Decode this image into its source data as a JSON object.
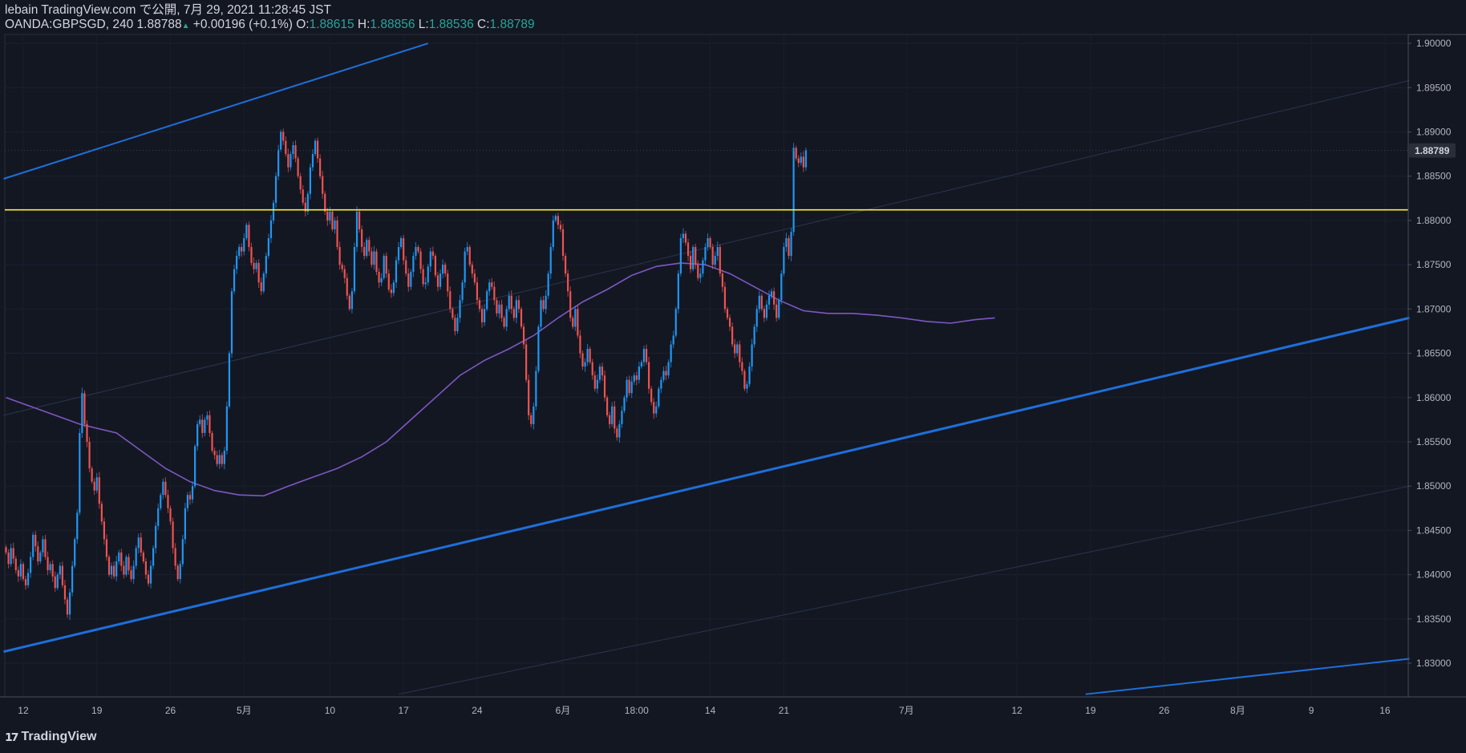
{
  "header": {
    "line1": "lebain TradingView.com で公開, 7月 29, 2021 11:28:45 JST",
    "symbol": "OANDA:GBPSGD, 240",
    "last": "1.88788",
    "change": "+0.00196 (+0.1%)",
    "o_label": "O:",
    "o_val": "1.88615",
    "h_label": "H:",
    "h_val": "1.88856",
    "l_label": "L:",
    "l_val": "1.88536",
    "c_label": "C:",
    "c_val": "1.88789"
  },
  "price_badge": "1.88789",
  "footer": {
    "logo_text": "TradingView"
  },
  "colors": {
    "background": "#131722",
    "up_candle": "#2196f3",
    "down_candle": "#ef5350",
    "ma": "#7e57c2",
    "horizontal_level": "#ffeb3b",
    "trendline": "#2962ff",
    "text": "#d1d4dc"
  },
  "chart_data": {
    "type": "candlestick",
    "symbol": "OANDA:GBPSGD",
    "timeframe": "240",
    "y_ticks": [
      "1.83000",
      "1.83500",
      "1.84000",
      "1.84500",
      "1.85000",
      "1.85500",
      "1.86000",
      "1.86500",
      "1.87000",
      "1.87500",
      "1.88000",
      "1.88500",
      "1.89000",
      "1.89500",
      "1.90000"
    ],
    "x_ticks": [
      {
        "label": "12",
        "idx": 7
      },
      {
        "label": "19",
        "idx": 37
      },
      {
        "label": "26",
        "idx": 67
      },
      {
        "label": "5月",
        "idx": 97
      },
      {
        "label": "10",
        "idx": 132
      },
      {
        "label": "17",
        "idx": 162
      },
      {
        "label": "24",
        "idx": 192
      },
      {
        "label": "6月",
        "idx": 227
      },
      {
        "label": "18:00",
        "idx": 257
      },
      {
        "label": "14",
        "idx": 287
      },
      {
        "label": "21",
        "idx": 317
      },
      {
        "label": "7月",
        "idx": 367
      },
      {
        "label": "12",
        "idx": 412
      },
      {
        "label": "19",
        "idx": 442
      },
      {
        "label": "26",
        "idx": 472
      },
      {
        "label": "8月",
        "idx": 502
      },
      {
        "label": "9",
        "idx": 532
      },
      {
        "label": "16",
        "idx": 562
      }
    ],
    "horizontal_level": 1.8812,
    "closes": [
      1.8425,
      1.8412,
      1.843,
      1.8418,
      1.8405,
      1.8398,
      1.8412,
      1.8395,
      1.8388,
      1.8402,
      1.842,
      1.8445,
      1.8432,
      1.8415,
      1.8425,
      1.844,
      1.842,
      1.8405,
      1.8412,
      1.8398,
      1.8385,
      1.84,
      1.841,
      1.8388,
      1.8372,
      1.8355,
      1.838,
      1.841,
      1.844,
      1.847,
      1.856,
      1.8605,
      1.857,
      1.855,
      1.852,
      1.8505,
      1.8495,
      1.851,
      1.848,
      1.846,
      1.844,
      1.842,
      1.84,
      1.841,
      1.8398,
      1.8415,
      1.8425,
      1.841,
      1.84,
      1.842,
      1.8405,
      1.8395,
      1.841,
      1.843,
      1.8442,
      1.8425,
      1.8415,
      1.84,
      1.839,
      1.841,
      1.843,
      1.8455,
      1.8475,
      1.849,
      1.8505,
      1.849,
      1.8475,
      1.846,
      1.843,
      1.841,
      1.8395,
      1.8412,
      1.844,
      1.8475,
      1.849,
      1.8485,
      1.85,
      1.8545,
      1.857,
      1.8575,
      1.856,
      1.8575,
      1.858,
      1.856,
      1.854,
      1.8535,
      1.8525,
      1.8535,
      1.8525,
      1.854,
      1.859,
      1.865,
      1.872,
      1.8745,
      1.876,
      1.877,
      1.8765,
      1.878,
      1.8795,
      1.877,
      1.8752,
      1.8745,
      1.8752,
      1.873,
      1.872,
      1.874,
      1.876,
      1.878,
      1.88,
      1.882,
      1.885,
      1.888,
      1.89,
      1.889,
      1.8875,
      1.886,
      1.8875,
      1.8885,
      1.887,
      1.885,
      1.8835,
      1.882,
      1.881,
      1.883,
      1.886,
      1.8875,
      1.889,
      1.887,
      1.885,
      1.883,
      1.881,
      1.88,
      1.881,
      1.879,
      1.88,
      1.877,
      1.875,
      1.8745,
      1.8735,
      1.8715,
      1.87,
      1.872,
      1.877,
      1.881,
      1.879,
      1.877,
      1.876,
      1.8778,
      1.8765,
      1.875,
      1.8765,
      1.8742,
      1.873,
      1.8735,
      1.876,
      1.874,
      1.8722,
      1.8718,
      1.873,
      1.8755,
      1.877,
      1.878,
      1.8755,
      1.874,
      1.8725,
      1.8742,
      1.876,
      1.877,
      1.8765,
      1.8745,
      1.8728,
      1.873,
      1.8748,
      1.8765,
      1.876,
      1.8738,
      1.8725,
      1.874,
      1.875,
      1.874,
      1.872,
      1.87,
      1.869,
      1.8675,
      1.869,
      1.871,
      1.873,
      1.8765,
      1.877,
      1.875,
      1.874,
      1.873,
      1.871,
      1.87,
      1.8685,
      1.87,
      1.872,
      1.873,
      1.8725,
      1.871,
      1.8695,
      1.8705,
      1.869,
      1.868,
      1.87,
      1.8715,
      1.87,
      1.869,
      1.871,
      1.87,
      1.868,
      1.866,
      1.862,
      1.858,
      1.857,
      1.859,
      1.863,
      1.868,
      1.871,
      1.87,
      1.8715,
      1.874,
      1.877,
      1.88,
      1.8805,
      1.8795,
      1.879,
      1.876,
      1.874,
      1.872,
      1.869,
      1.868,
      1.87,
      1.867,
      1.865,
      1.8635,
      1.864,
      1.8655,
      1.864,
      1.8625,
      1.861,
      1.862,
      1.8635,
      1.8625,
      1.86,
      1.858,
      1.857,
      1.859,
      1.8565,
      1.8555,
      1.857,
      1.8585,
      1.86,
      1.862,
      1.8605,
      1.8618,
      1.8625,
      1.862,
      1.8635,
      1.864,
      1.8655,
      1.864,
      1.861,
      1.8595,
      1.8582,
      1.859,
      1.861,
      1.862,
      1.863,
      1.8625,
      1.864,
      1.866,
      1.867,
      1.87,
      1.874,
      1.878,
      1.8785,
      1.8775,
      1.876,
      1.8745,
      1.877,
      1.875,
      1.8735,
      1.874,
      1.8755,
      1.877,
      1.878,
      1.877,
      1.875,
      1.876,
      1.877,
      1.874,
      1.8725,
      1.87,
      1.869,
      1.868,
      1.866,
      1.865,
      1.866,
      1.864,
      1.863,
      1.861,
      1.8615,
      1.8635,
      1.866,
      1.868,
      1.87,
      1.8715,
      1.87,
      1.869,
      1.8705,
      1.8715,
      1.872,
      1.8705,
      1.869,
      1.871,
      1.874,
      1.877,
      1.878,
      1.876,
      1.8787,
      1.8882,
      1.887,
      1.8865,
      1.8872,
      1.886,
      1.8879
    ],
    "ma_points": [
      [
        0,
        1.86
      ],
      [
        15,
        1.8585
      ],
      [
        30,
        1.857
      ],
      [
        45,
        1.856
      ],
      [
        55,
        1.854
      ],
      [
        65,
        1.852
      ],
      [
        75,
        1.8505
      ],
      [
        85,
        1.8495
      ],
      [
        95,
        1.849
      ],
      [
        105,
        1.8489
      ],
      [
        115,
        1.85
      ],
      [
        125,
        1.851
      ],
      [
        135,
        1.852
      ],
      [
        145,
        1.8533
      ],
      [
        155,
        1.855
      ],
      [
        165,
        1.8575
      ],
      [
        175,
        1.86
      ],
      [
        185,
        1.8625
      ],
      [
        195,
        1.8642
      ],
      [
        205,
        1.8655
      ],
      [
        215,
        1.867
      ],
      [
        225,
        1.869
      ],
      [
        235,
        1.8708
      ],
      [
        245,
        1.8722
      ],
      [
        255,
        1.8738
      ],
      [
        265,
        1.8748
      ],
      [
        275,
        1.8752
      ],
      [
        285,
        1.875
      ],
      [
        295,
        1.874
      ],
      [
        305,
        1.8725
      ],
      [
        315,
        1.871
      ],
      [
        325,
        1.8698
      ],
      [
        335,
        1.8695
      ],
      [
        345,
        1.8695
      ],
      [
        355,
        1.8693
      ],
      [
        365,
        1.869
      ],
      [
        375,
        1.8686
      ],
      [
        385,
        1.8684
      ],
      [
        395,
        1.8688
      ],
      [
        403,
        1.869
      ]
    ],
    "lower_trendline": [
      {
        "x": -1,
        "y": 1.8313
      },
      {
        "x": 572,
        "y": 1.869
      }
    ],
    "upper_trendline": [
      {
        "x": -1,
        "y": 1.8847
      },
      {
        "x": 172,
        "y": 1.9
      }
    ],
    "far_trendline": [
      {
        "x": 440,
        "y": 1.8265
      },
      {
        "x": 572,
        "y": 1.8305
      }
    ],
    "parallel_lines": [
      [
        {
          "x": -1,
          "y": 1.858
        },
        {
          "x": 572,
          "y": 1.8958
        }
      ],
      [
        {
          "x": 160,
          "y": 1.8265
        },
        {
          "x": 572,
          "y": 1.85
        }
      ]
    ]
  }
}
